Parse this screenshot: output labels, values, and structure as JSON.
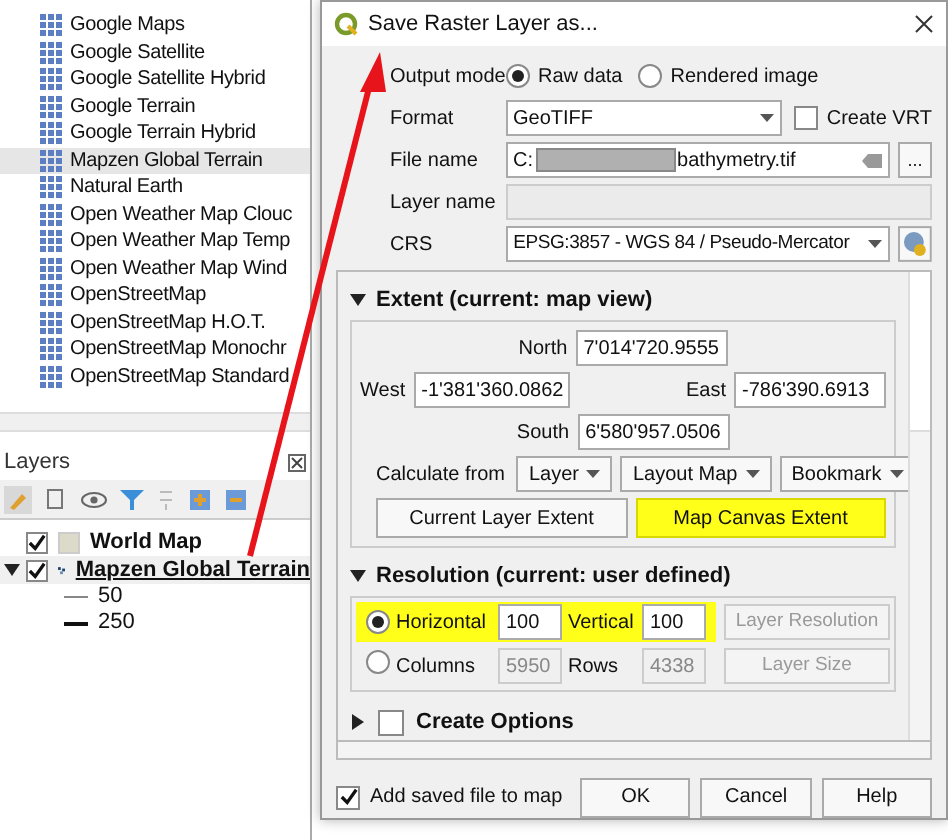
{
  "browser": {
    "items": [
      {
        "label": "Google Maps",
        "selected": false
      },
      {
        "label": "Google Satellite",
        "selected": false
      },
      {
        "label": "Google Satellite Hybrid",
        "selected": false
      },
      {
        "label": "Google Terrain",
        "selected": false
      },
      {
        "label": "Google Terrain Hybrid",
        "selected": false
      },
      {
        "label": "Mapzen Global Terrain",
        "selected": true
      },
      {
        "label": "Natural Earth",
        "selected": false
      },
      {
        "label": "Open Weather Map Clouc",
        "selected": false
      },
      {
        "label": "Open Weather Map Temp",
        "selected": false
      },
      {
        "label": "Open Weather Map Wind",
        "selected": false
      },
      {
        "label": "OpenStreetMap",
        "selected": false
      },
      {
        "label": "OpenStreetMap H.O.T.",
        "selected": false
      },
      {
        "label": "OpenStreetMap Monochr",
        "selected": false
      },
      {
        "label": "OpenStreetMap Standard",
        "selected": false
      }
    ]
  },
  "layers": {
    "title": "Layers",
    "items": [
      {
        "label": "World Map",
        "checked": true,
        "kind": "vector",
        "expanded": false
      },
      {
        "label": "Mapzen Global Terrain",
        "checked": true,
        "kind": "raster",
        "expanded": true,
        "children": [
          {
            "label": "50",
            "kind": "thin"
          },
          {
            "label": "250",
            "kind": "thick"
          }
        ]
      }
    ]
  },
  "dialog": {
    "title": "Save Raster Layer as...",
    "output_mode": {
      "label": "Output mode",
      "options": [
        {
          "label": "Raw data",
          "selected": true
        },
        {
          "label": "Rendered image",
          "selected": false
        }
      ]
    },
    "format": {
      "label": "Format",
      "value": "GeoTIFF",
      "create_vrt": {
        "label": "Create VRT",
        "checked": false
      }
    },
    "file_name": {
      "label": "File name",
      "value_start": "C:",
      "value_end": "bathymetry.tif",
      "browse": "..."
    },
    "layer_name": {
      "label": "Layer name"
    },
    "crs": {
      "label": "CRS",
      "value": "EPSG:3857 - WGS 84 / Pseudo-Mercator"
    },
    "extent": {
      "title": "Extent (current: map view)",
      "expanded": true,
      "north": {
        "label": "North",
        "value": "7'014'720.9555"
      },
      "west": {
        "label": "West",
        "value": "-1'381'360.0862"
      },
      "east": {
        "label": "East",
        "value": "-786'390.6913"
      },
      "south": {
        "label": "South",
        "value": "6'580'957.0506"
      },
      "calculate_from": "Calculate from",
      "dropdowns": [
        "Layer",
        "Layout Map",
        "Bookmark"
      ],
      "buttons": [
        {
          "label": "Current Layer Extent",
          "highlighted": false
        },
        {
          "label": "Map Canvas Extent",
          "highlighted": true
        }
      ]
    },
    "resolution": {
      "title": "Resolution (current: user defined)",
      "expanded": true,
      "rows": [
        {
          "label": "Horizontal",
          "selected": true,
          "highlighted": true,
          "field_1": "100",
          "label_2": "Vertical",
          "field_2": "100",
          "button": "Layer Resolution"
        },
        {
          "label": "Columns",
          "selected": false,
          "highlighted": false,
          "field_1": "5950",
          "label_2": "Rows",
          "field_2": "4338",
          "button": "Layer Size"
        }
      ]
    },
    "create_options": {
      "label": "Create Options",
      "checked": false,
      "expanded": false
    },
    "add_to_map": {
      "label": "Add saved file to map",
      "checked": true
    },
    "buttons": [
      "OK",
      "Cancel",
      "Help"
    ]
  }
}
